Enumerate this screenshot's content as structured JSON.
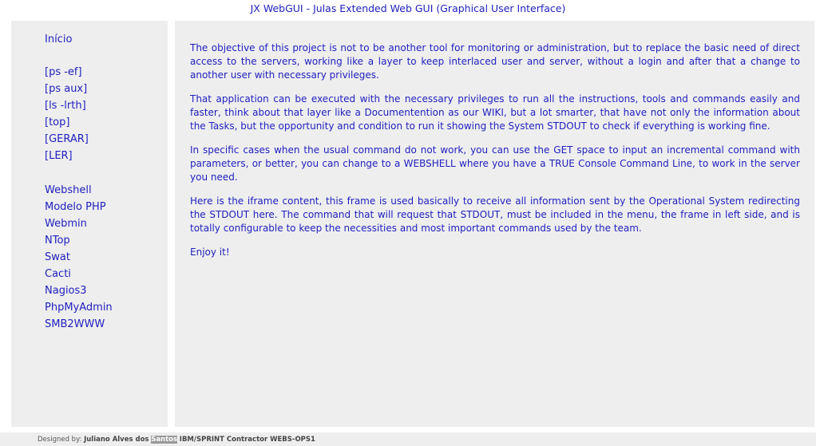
{
  "header": {
    "title": "JX WebGUI - Julas Extended Web GUI (Graphical User Interface)"
  },
  "sidebar": {
    "home": "Início",
    "commands": [
      "[ps -ef]",
      "[ps aux]",
      "[ls -lrth]",
      "[top]",
      "[GERAR]",
      "[LER]"
    ],
    "tools": [
      "Webshell",
      "Modelo PHP",
      "Webmin",
      "NTop",
      "Swat",
      "Cacti",
      "Nagios3",
      "PhpMyAdmin",
      "SMB2WWW"
    ]
  },
  "content": {
    "paragraphs": [
      "The objective of this project is not to be another tool for monitoring or administration, but to replace the basic need of direct access to the servers, working like a layer to keep interlaced user and server, without a login and after that a change to another user with necessary privileges.",
      "That application can be executed with the necessary privileges to run all the instructions, tools and commands easily and faster, think about that layer like a Documentention as our WIKI, but a lot smarter, that have not only the information about the Tasks, but the opportunity and condition to run it showing the System STDOUT to check if everything is working fine.",
      "In specific cases when the usual command do not work, you can use the GET space to input an incremental command with parameters, or better, you can change to a WEBSHELL where you have a TRUE Console Command Line, to work in the server you need.",
      "Here is the iframe content, this frame is used basically to receive all information sent by the Operational System redirecting the STDOUT here. The command that will request that STDOUT, must be included in the menu, the frame in left side, and is totally configurable to keep the necessities and most important commands used by the team.",
      "Enjoy it!"
    ]
  },
  "footer": {
    "prefix": "Designed by:",
    "author_start": "Juliano Alves dos",
    "author_highlight": "Santos",
    "org": "IBM/SPRINT Contractor WEBS-OPS1"
  }
}
